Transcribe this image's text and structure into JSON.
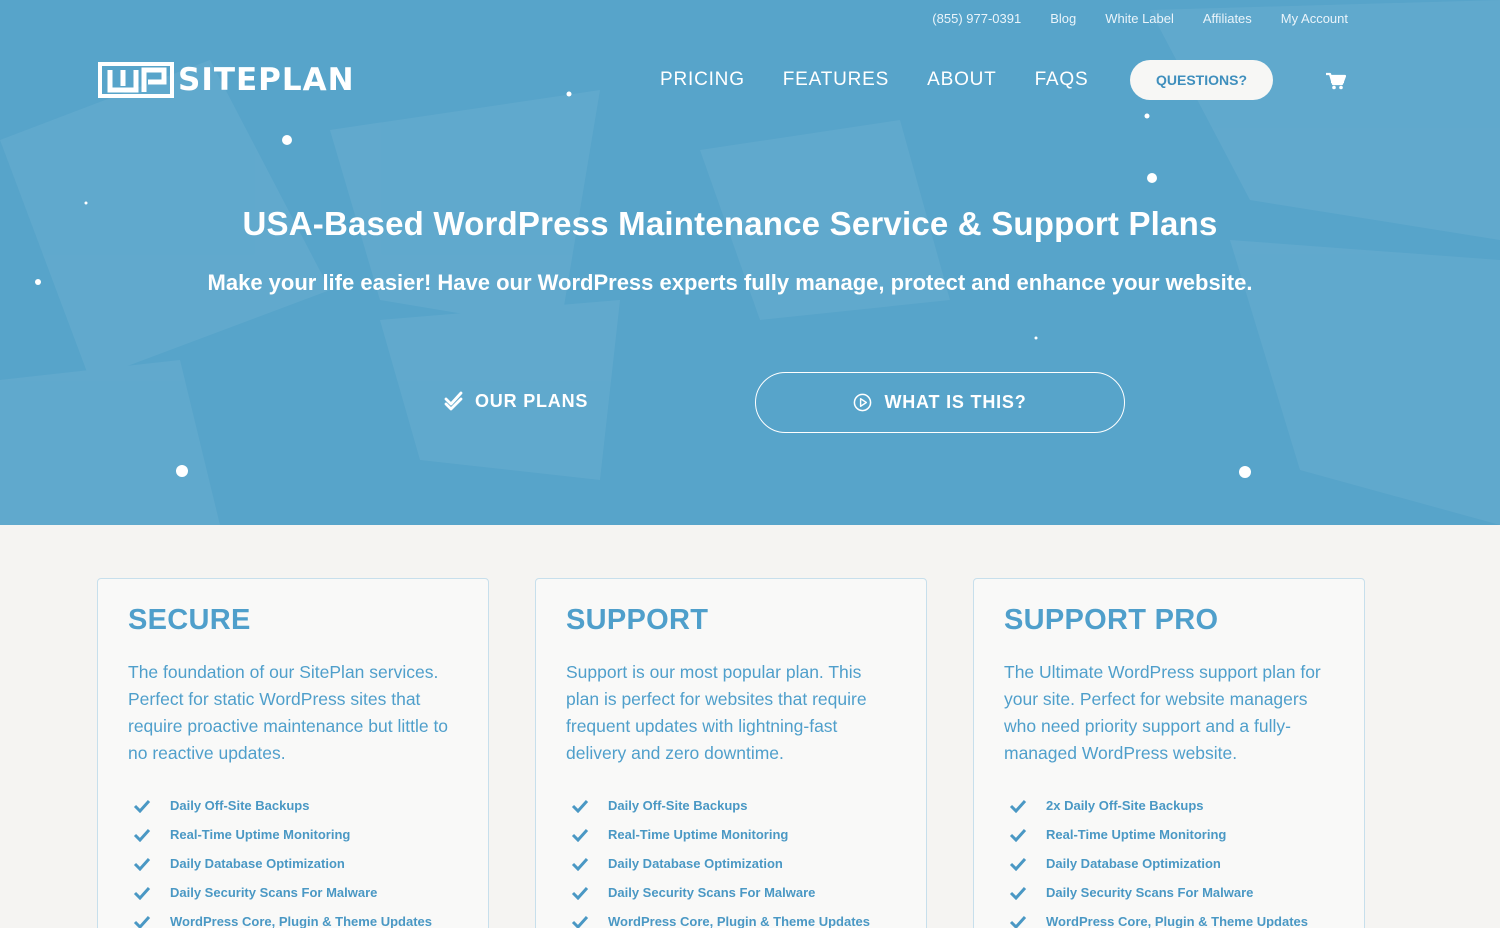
{
  "topbar": {
    "phone": "(855) 977-0391",
    "blog": "Blog",
    "white_label": "White Label",
    "affiliates": "Affiliates",
    "my_account": "My Account"
  },
  "logo": {
    "text": "SITEPLAN",
    "mark": "WP"
  },
  "nav": {
    "pricing": "PRICING",
    "features": "FEATURES",
    "about": "ABOUT",
    "faqs": "FAQS",
    "questions": "QUESTIONS?"
  },
  "hero": {
    "title": "USA-Based WordPress Maintenance Service & Support Plans",
    "subtitle": "Make your life easier! Have our WordPress experts fully manage, protect and enhance your website.",
    "btn_plans": "OUR PLANS",
    "btn_what": "WHAT IS THIS?"
  },
  "colors": {
    "hero_bg": "#57a4ca",
    "accent": "#4f9fcb",
    "page_bg": "#f5f4f2"
  },
  "icons": [
    "check-double-icon",
    "play-circle-icon",
    "cart-icon",
    "checkmark-icon"
  ],
  "plans": [
    {
      "name": "SECURE",
      "desc": "The foundation of our SitePlan services. Perfect for static WordPress sites that require proactive maintenance but little to no reactive updates.",
      "features": [
        "Daily Off-Site Backups",
        "Real-Time Uptime Monitoring",
        "Daily Database Optimization",
        "Daily Security Scans For Malware",
        "WordPress Core, Plugin & Theme Updates"
      ]
    },
    {
      "name": "SUPPORT",
      "desc": "Support is our most popular plan. This plan is perfect for websites that require frequent updates with lightning-fast delivery and zero downtime.",
      "features": [
        "Daily Off-Site Backups",
        "Real-Time Uptime Monitoring",
        "Daily Database Optimization",
        "Daily Security Scans For Malware",
        "WordPress Core, Plugin & Theme Updates"
      ]
    },
    {
      "name": "SUPPORT PRO",
      "desc": "The Ultimate WordPress support plan for your site. Perfect for website managers who need priority support and a fully-managed WordPress website.",
      "features": [
        "2x Daily Off-Site Backups",
        "Real-Time Uptime Monitoring",
        "Daily Database Optimization",
        "Daily Security Scans For Malware",
        "WordPress Core, Plugin & Theme Updates"
      ]
    }
  ]
}
